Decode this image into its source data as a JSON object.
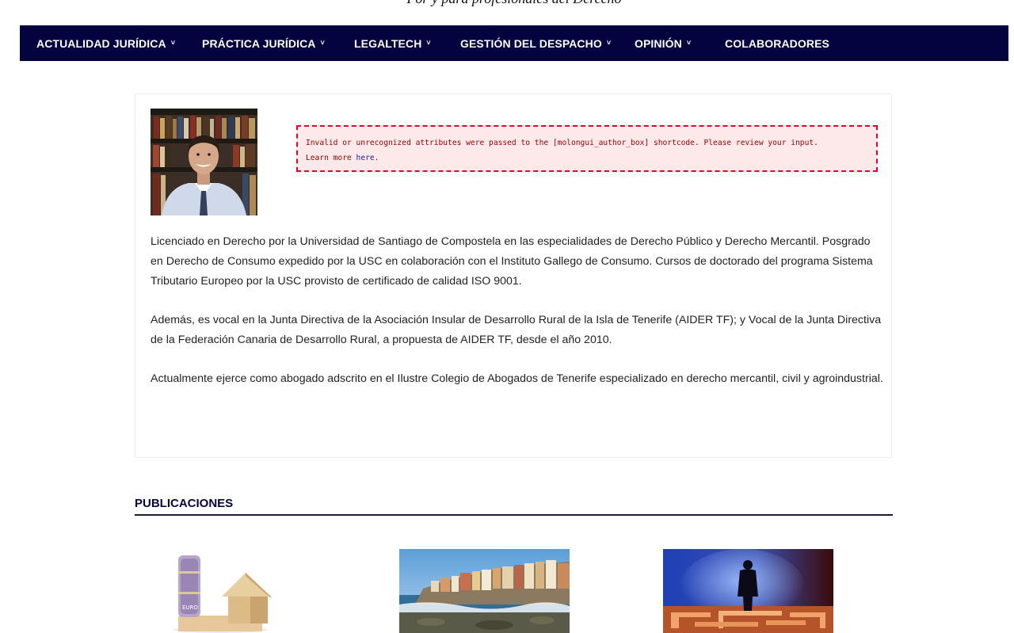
{
  "header": {
    "tagline": "Por y para profesionales del Derecho"
  },
  "nav": {
    "items": [
      {
        "label": "ACTUALIDAD JURÍDICA",
        "has_dropdown": true
      },
      {
        "label": "PRÁCTICA JURÍDICA",
        "has_dropdown": true
      },
      {
        "label": "LEGALTECH",
        "has_dropdown": true
      },
      {
        "label": "GESTIÓN DEL DESPACHO",
        "has_dropdown": true
      },
      {
        "label": "OPINIÓN",
        "has_dropdown": true
      },
      {
        "label": "COLABORADORES",
        "has_dropdown": false
      }
    ],
    "chevron": "˅"
  },
  "author": {
    "error_message": "Invalid or unrecognized attributes were passed to the [molongui_author_box] shortcode. Please review your input.",
    "error_learn_more": "Learn more",
    "error_link": "here",
    "error_end": ".",
    "bio": [
      "Licenciado en Derecho por la Universidad de Santiago de Compostela en las especialidades de Derecho Público y Derecho Mercantil. Posgrado en Derecho de Consumo expedido por la USC en colaboración con el Instituto Gallego de Consumo.  Cursos de doctorado del programa Sistema Tributario Europeo  por la USC provisto de  certificado de calidad ISO 9001.",
      "Además, es vocal en la Junta Directiva de la Asociación Insular de Desarrollo Rural de la Isla de Tenerife (AIDER TF); y  Vocal de la Junta Directiva de la Federación Canaria de Desarrollo Rural, a propuesta de AIDER TF, desde el año 2010.",
      "Actualmente ejerce como abogado adscrito en el Ilustre Colegio de Abogados de Tenerife especializado en derecho mercantil, civil y agroindustrial."
    ]
  },
  "publications": {
    "heading": "PUBLICACIONES",
    "money_label": "EURO"
  },
  "colors": {
    "nav_bg": "#02033f",
    "error_border": "#e3002b",
    "error_bg": "#fde9e9"
  }
}
